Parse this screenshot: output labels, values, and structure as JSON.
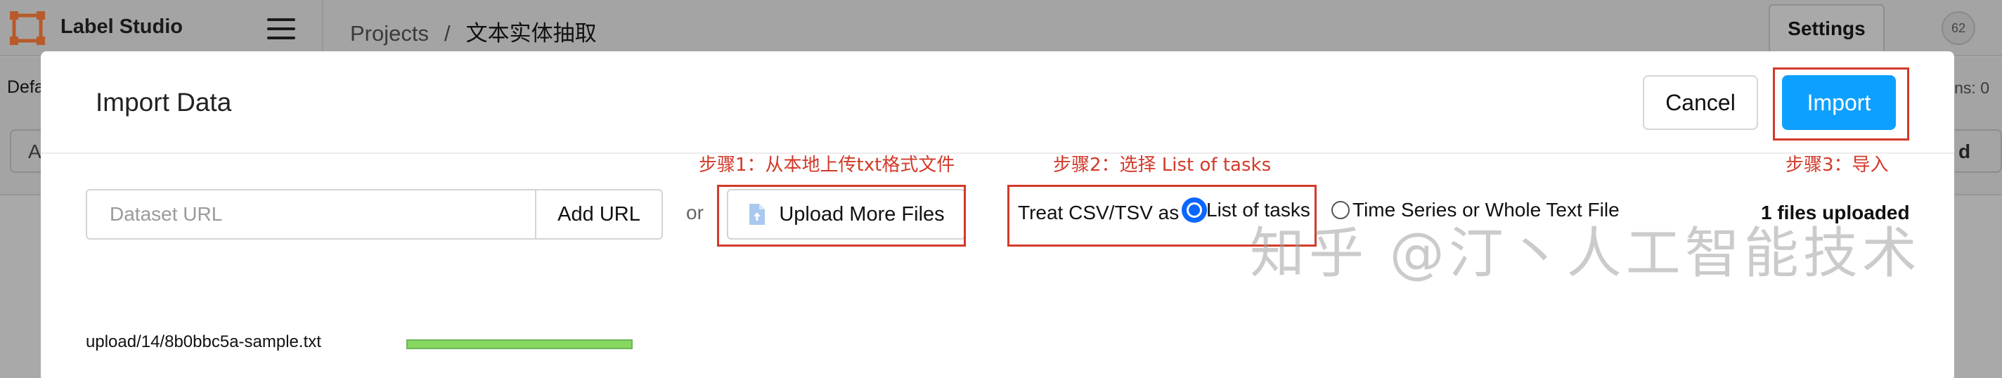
{
  "app": {
    "title": "Label Studio",
    "breadcrumb": [
      "Projects",
      "文本实体抽取"
    ],
    "breadcrumb_separator": "/",
    "settings_label": "Settings",
    "avatar_initials": "62"
  },
  "background": {
    "left_text": "Defa",
    "right_text": "ns: 0",
    "left_box_text": "A",
    "right_box_text": "d"
  },
  "modal": {
    "title": "Import Data",
    "cancel_label": "Cancel",
    "import_label": "Import",
    "url_placeholder": "Dataset URL",
    "add_url_label": "Add URL",
    "or_label": "or",
    "upload_label": "Upload More Files",
    "treat_label": "Treat CSV/TSV as",
    "option_list": "List of tasks",
    "option_time": "Time Series or Whole Text File",
    "selected_option": "List of tasks",
    "files_uploaded": "1 files uploaded",
    "file": {
      "name": "upload/14/8b0bbc5a-sample.txt",
      "progress": 1.0
    }
  },
  "annotations": {
    "step1": "步骤1：从本地上传txt格式文件",
    "step2": "步骤2：选择 List of tasks",
    "step3": "步骤3：导入",
    "color": "#d23a2a"
  },
  "watermark": "知乎 @汀丶人工智能技术",
  "colors": {
    "primary": "#0ea0ff",
    "progress": "#86d85f",
    "annotation": "#d23a2a"
  }
}
